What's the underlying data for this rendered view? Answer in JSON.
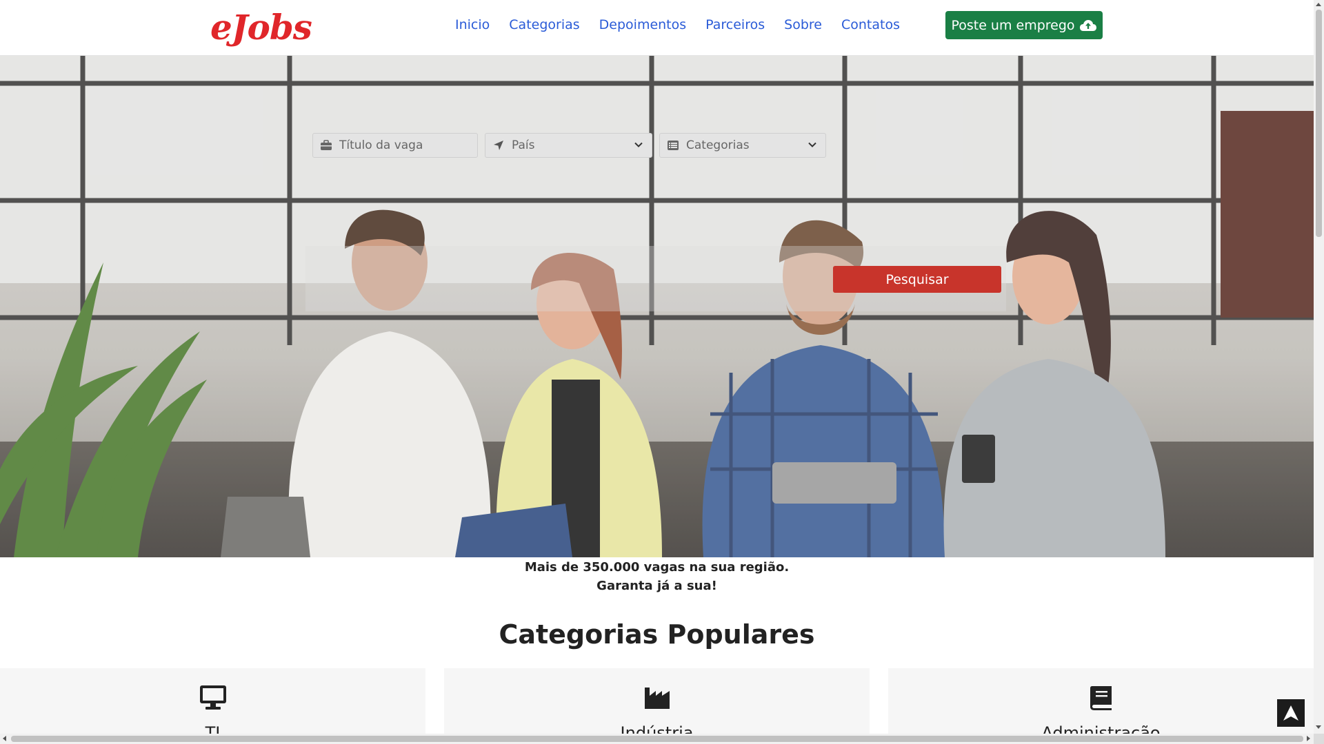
{
  "header": {
    "logo": "eJobs",
    "nav": [
      "Inicio",
      "Categorias",
      "Depoimentos",
      "Parceiros",
      "Sobre",
      "Contatos"
    ],
    "post_job_label": "Poste um emprego",
    "post_job_icon": "cloud-upload-icon"
  },
  "search": {
    "title_placeholder": "Título da vaga",
    "title_icon": "briefcase-icon",
    "country_value": "País",
    "country_icon": "location-arrow-icon",
    "category_value": "Categorias",
    "category_icon": "list-icon",
    "button_label": "Pesquisar"
  },
  "tagline": {
    "line1": "Mais de 350.000 vagas na sua região.",
    "line2": "Garanta já a sua!"
  },
  "popular": {
    "title": "Categorias Populares",
    "cards": [
      {
        "label": "TI",
        "icon": "desktop-icon"
      },
      {
        "label": "Indústria",
        "icon": "industry-icon"
      },
      {
        "label": "Administração",
        "icon": "book-icon"
      }
    ]
  },
  "colors": {
    "brand_red": "#e0262a",
    "nav_blue": "#2a5bd7",
    "post_green": "#1a7f45",
    "search_red": "#c8342b"
  }
}
